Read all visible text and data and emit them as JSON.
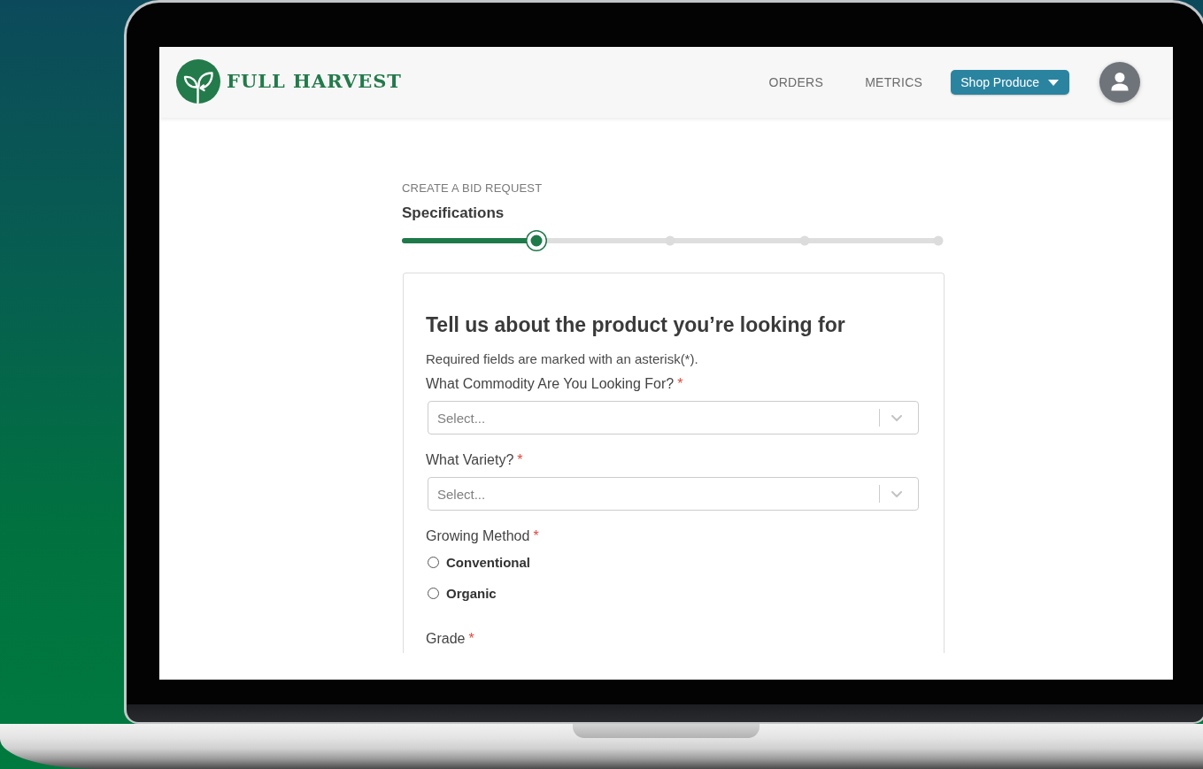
{
  "header": {
    "logo_text": "FULL HARVEST",
    "nav": [
      {
        "label": "ORDERS"
      },
      {
        "label": "METRICS"
      }
    ],
    "menu_button": {
      "label": "Shop Produce"
    }
  },
  "page": {
    "eyebrow": "CREATE A BID REQUEST",
    "step_title": "Specifications",
    "progress": {
      "level": 0.25,
      "steps": [
        {
          "selected": true
        },
        {
          "selected": false
        },
        {
          "selected": false
        },
        {
          "selected": false
        }
      ]
    }
  },
  "form": {
    "title": "Tell us about the product you’re looking for",
    "note": "Required fields are marked with an asterisk(*).",
    "fields": [
      {
        "kind": "select",
        "label": "What Commodity Are You Looking For?",
        "required_mark": "*",
        "placeholder": "Select..."
      },
      {
        "kind": "select",
        "label": "What Variety?",
        "required_mark": "*",
        "placeholder": "Select..."
      },
      {
        "kind": "radio",
        "label": "Growing Method",
        "required_mark": "*",
        "options": [
          {
            "label": "Conventional",
            "selected": false
          },
          {
            "label": "Organic",
            "selected": false
          }
        ]
      },
      {
        "kind": "label",
        "label": "Grade",
        "required_mark": "*"
      }
    ]
  }
}
